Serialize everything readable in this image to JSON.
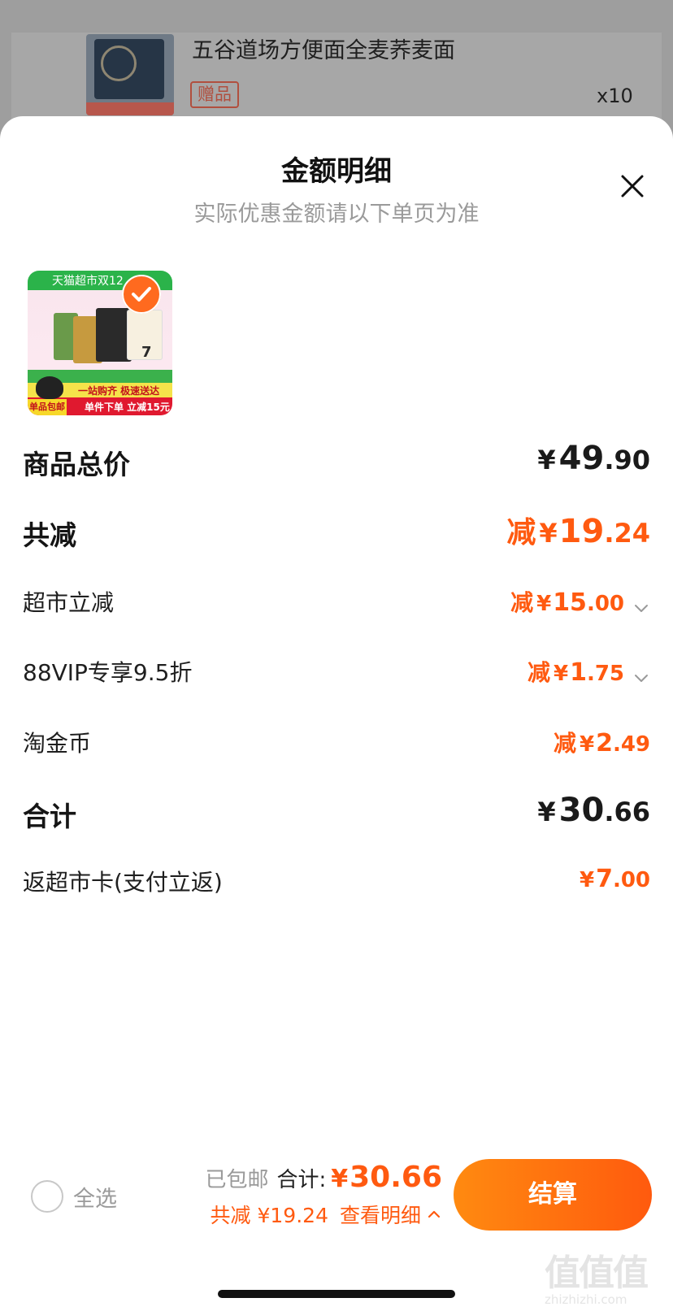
{
  "background": {
    "product_title": "五谷道场方便面全麦荞麦面",
    "gift_tag": "赠品",
    "quantity": "x10"
  },
  "sheet": {
    "title": "金额明细",
    "subtitle": "实际优惠金额请以下单页为准"
  },
  "product_image": {
    "banner_text": "天猫超市双12",
    "ribbon_text": "一站购齐 极速送达",
    "promo_text": "单件下单 立减15元",
    "corner_badge": "单品包邮",
    "count_text": "7"
  },
  "rows": {
    "goods_total": {
      "label": "商品总价",
      "currency": "¥",
      "int": "49",
      "dec": ".90"
    },
    "total_discount": {
      "label": "共减",
      "prefix": "减",
      "currency": "¥",
      "int": "19",
      "dec": ".24"
    },
    "supermarket_discount": {
      "label": "超市立减",
      "prefix": "减",
      "currency": "¥",
      "int": "15",
      "dec": ".00"
    },
    "vip_discount": {
      "label": "88VIP专享9.5折",
      "prefix": "减",
      "currency": "¥",
      "int": "1",
      "dec": ".75"
    },
    "coins": {
      "label": "淘金币",
      "prefix": "减",
      "currency": "¥",
      "int": "2",
      "dec": ".49"
    },
    "subtotal": {
      "label": "合计",
      "currency": "¥",
      "int": "30",
      "dec": ".66"
    },
    "card_cashback": {
      "label": "返超市卡(支付立返)",
      "currency": "¥",
      "int": "7",
      "dec": ".00"
    }
  },
  "bottom_bar": {
    "select_all": "全选",
    "free_shipping": "已包邮",
    "total_label": "合计:",
    "total_currency": "¥",
    "total_value": "30.66",
    "saved_text": "共减 ¥19.24",
    "view_detail": "查看明细",
    "checkout": "结算"
  },
  "watermark": {
    "glyphs": "值值值",
    "url": "zhizhizhi.com"
  },
  "colors": {
    "accent": "#ff5a10",
    "checkout_gradient_start": "#ff8a10",
    "muted": "#9a9a9a"
  }
}
